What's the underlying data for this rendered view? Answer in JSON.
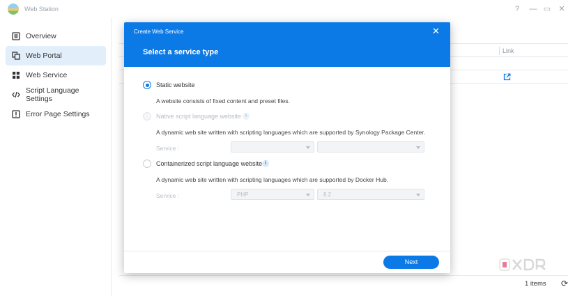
{
  "window": {
    "title": "Web Station",
    "controls": {
      "help": "?",
      "minimize": "—",
      "maximize": "▭",
      "close": "✕"
    }
  },
  "sidebar": {
    "items": [
      {
        "label": "Overview",
        "icon": "overview-icon",
        "active": false
      },
      {
        "label": "Web Portal",
        "icon": "web-portal-icon",
        "active": true
      },
      {
        "label": "Web Service",
        "icon": "grid-icon",
        "active": false
      },
      {
        "label": "Script Language Settings",
        "icon": "code-icon",
        "active": false
      },
      {
        "label": "Error Page Settings",
        "icon": "alert-icon",
        "active": false
      }
    ]
  },
  "main": {
    "table": {
      "columns": {
        "link": "Link"
      }
    },
    "footer": {
      "items_count": "1 items"
    }
  },
  "dialog": {
    "caption": "Create Web Service",
    "heading": "Select a service type",
    "close": "✕",
    "options": [
      {
        "label": "Static website",
        "description": "A website consists of fixed content and preset files.",
        "selected": true,
        "disabled": false
      },
      {
        "label": "Native script language website",
        "description": "A dynamic web site written with scripting languages which are supported by Synology Package Center.",
        "selected": false,
        "disabled": true,
        "service_label": "Service :",
        "service_values": [
          "",
          ""
        ]
      },
      {
        "label": "Containerized script language website",
        "description": "A dynamic web site written with scripting languages which are supported by Docker Hub.",
        "selected": false,
        "disabled": false,
        "service_label": "Service :",
        "service_values": [
          "PHP",
          "8.2"
        ]
      }
    ],
    "next_label": "Next",
    "info_glyph": "i"
  },
  "colors": {
    "accent": "#0c7ae6",
    "active_nav": "#e3eefb"
  }
}
